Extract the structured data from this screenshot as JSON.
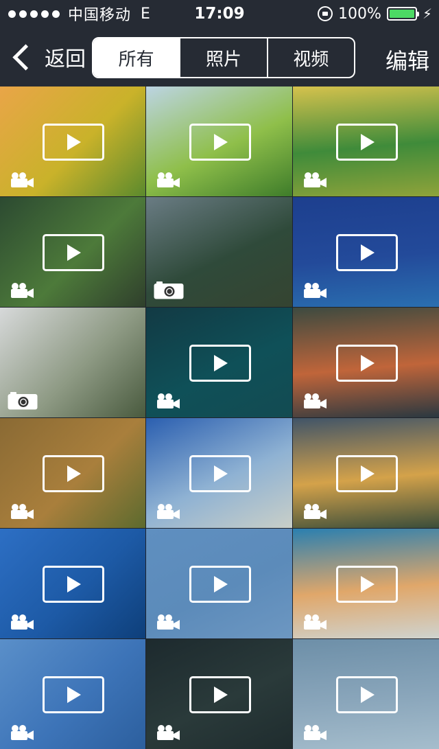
{
  "status_bar": {
    "carrier": "中国移动",
    "network": "E",
    "time": "17:09",
    "battery": "100%",
    "battery_level": 1.0,
    "battery_color": "#4cd964"
  },
  "nav": {
    "back_label": "返回",
    "tabs": [
      {
        "label": "所有",
        "selected": true
      },
      {
        "label": "照片",
        "selected": false
      },
      {
        "label": "视频",
        "selected": false
      }
    ],
    "edit_label": "编辑"
  },
  "grid": {
    "items": [
      {
        "type": "video",
        "colors": [
          "#e9a548",
          "#c9b22a",
          "#5b8a2d"
        ]
      },
      {
        "type": "video",
        "colors": [
          "#bcd4e3",
          "#8fbf4a",
          "#3e7c2a"
        ]
      },
      {
        "type": "video",
        "colors": [
          "#d6c24d",
          "#3f8b3a",
          "#8fa33a"
        ]
      },
      {
        "type": "video",
        "colors": [
          "#2c4a31",
          "#4d7a3a",
          "#2f3f2c"
        ]
      },
      {
        "type": "photo",
        "colors": [
          "#6a7c84",
          "#2f4a3a",
          "#354431"
        ]
      },
      {
        "type": "video",
        "colors": [
          "#1d3f8e",
          "#234a9a",
          "#2a6fb0"
        ]
      },
      {
        "type": "photo",
        "colors": [
          "#d7d9da",
          "#8e9a84",
          "#495a3e"
        ]
      },
      {
        "type": "video",
        "colors": [
          "#123a44",
          "#0f5058",
          "#134b52"
        ]
      },
      {
        "type": "video",
        "colors": [
          "#3c4a40",
          "#c0653a",
          "#2a3840"
        ]
      },
      {
        "type": "video",
        "colors": [
          "#8a6a34",
          "#a97f3c",
          "#5c6a2e"
        ]
      },
      {
        "type": "video",
        "colors": [
          "#2b5fb0",
          "#8fb2d3",
          "#c9cfc8"
        ]
      },
      {
        "type": "video",
        "colors": [
          "#405468",
          "#d4a24a",
          "#3a4d3a"
        ]
      },
      {
        "type": "video",
        "colors": [
          "#2d6fc4",
          "#1d5aa6",
          "#0e3f7a"
        ]
      },
      {
        "type": "video",
        "colors": [
          "#5f8fc0",
          "#5c8bba",
          "#6d97c1"
        ]
      },
      {
        "type": "video",
        "colors": [
          "#2a7fb0",
          "#e0a76a",
          "#cfd3cf"
        ]
      },
      {
        "type": "video",
        "colors": [
          "#5a8fc9",
          "#3d74b8",
          "#2c5f9e"
        ]
      },
      {
        "type": "video",
        "colors": [
          "#1d2a2e",
          "#2a3a3a",
          "#1f2c2e"
        ]
      },
      {
        "type": "video",
        "colors": [
          "#6d8fa8",
          "#8aa6bb",
          "#a5bdcc"
        ]
      }
    ]
  }
}
